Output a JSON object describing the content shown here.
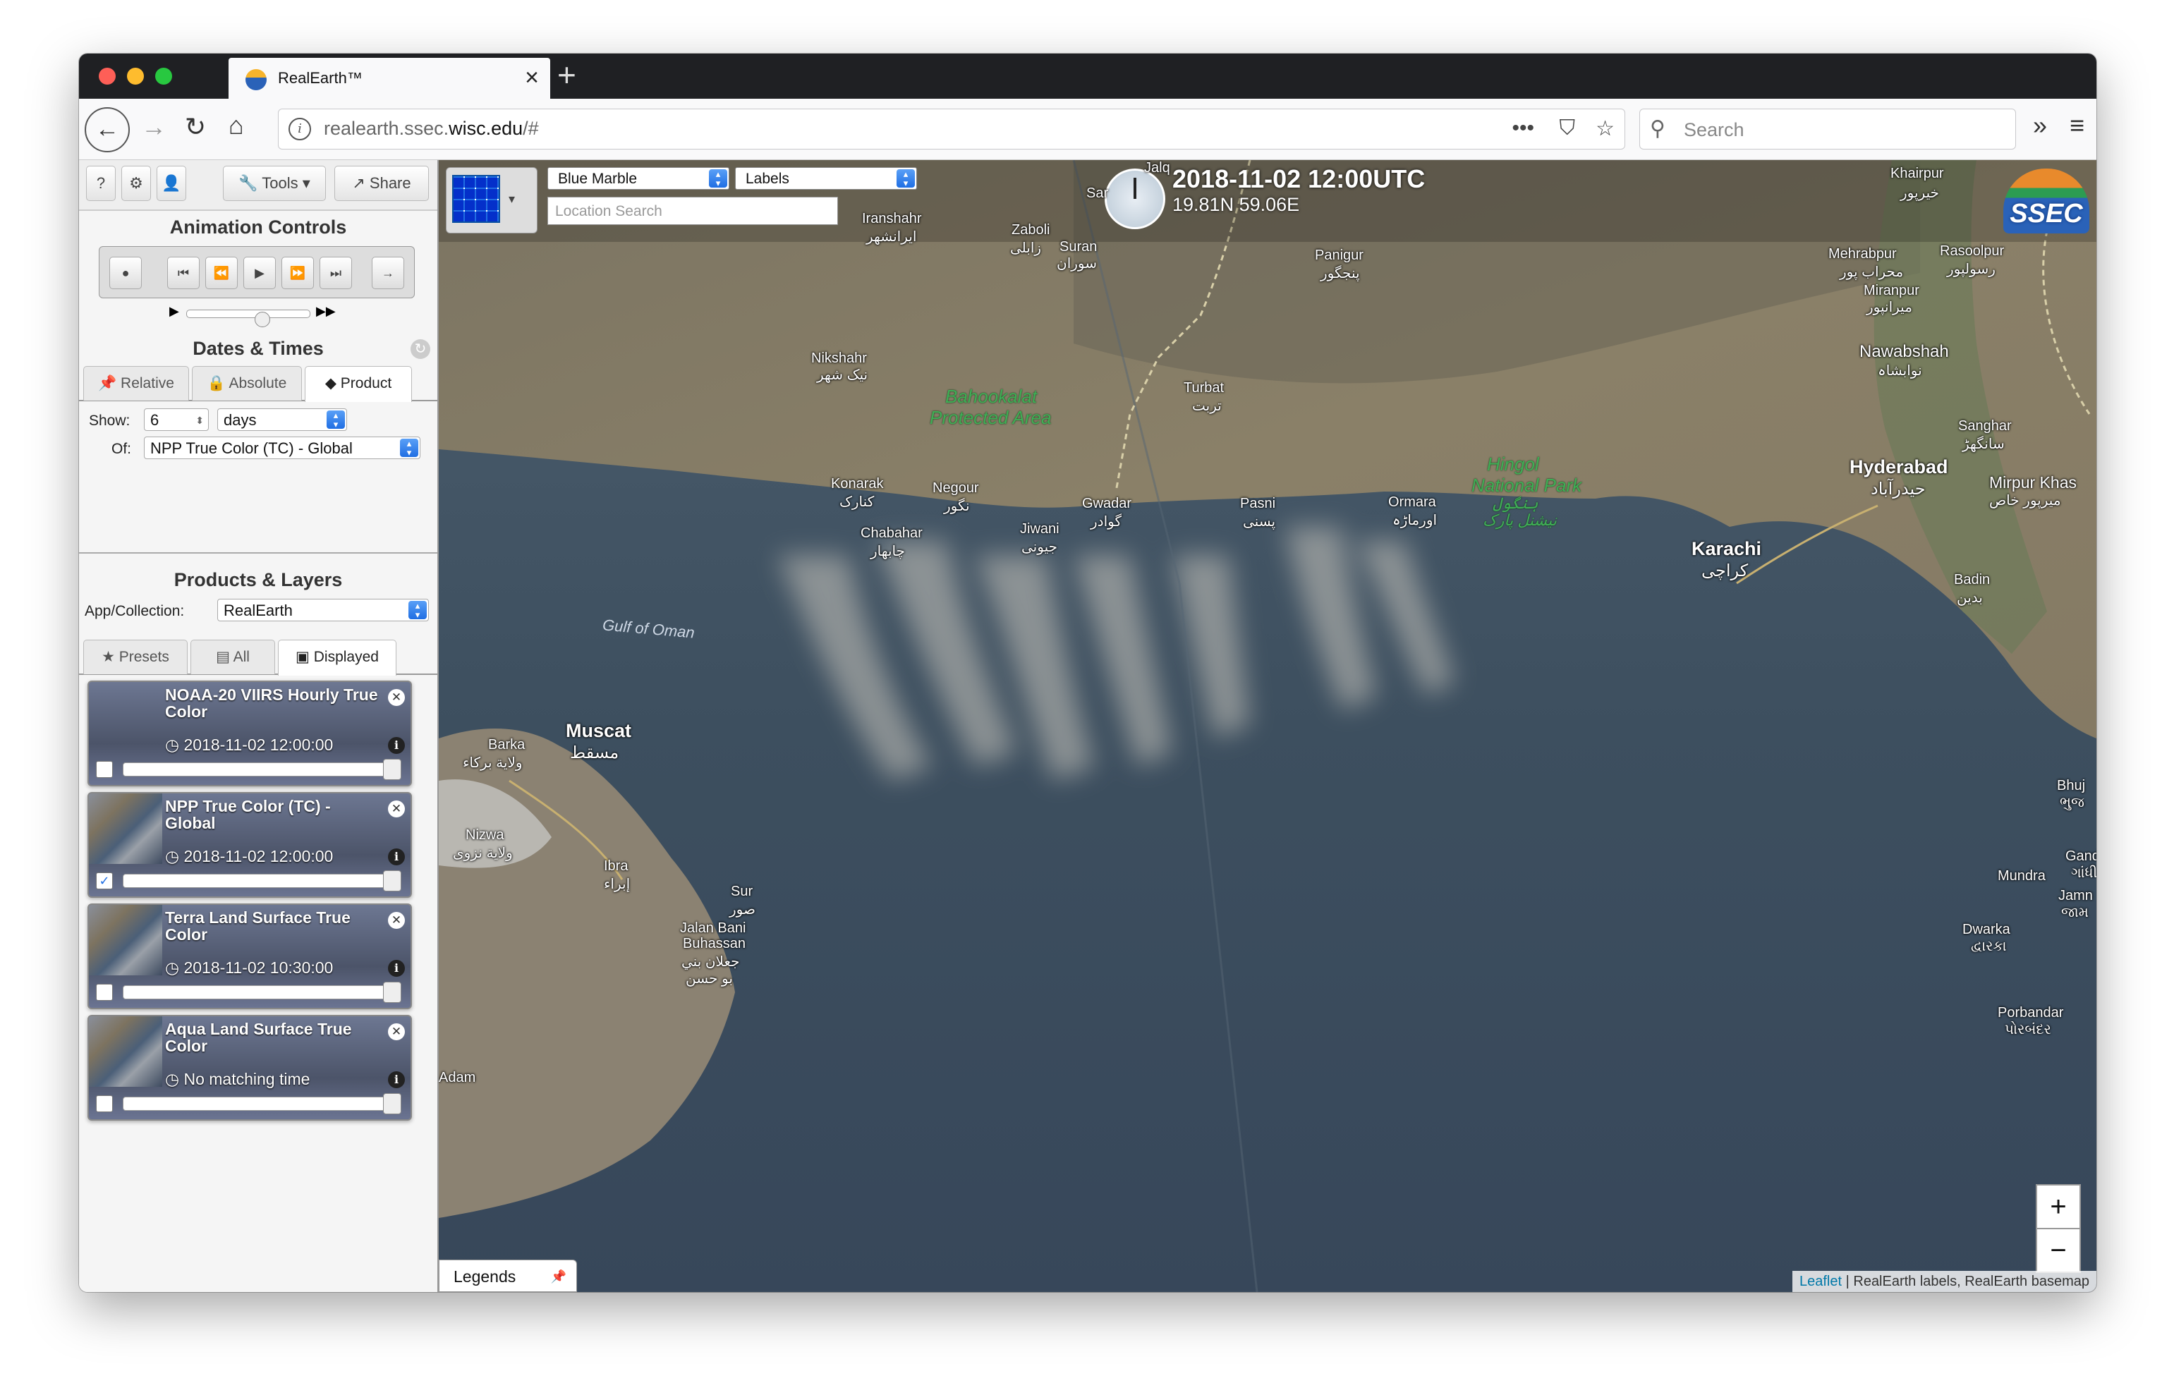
{
  "browser": {
    "tab_title": "RealEarth™",
    "url_host": "realearth.ssec.",
    "url_domain": "wisc.edu",
    "url_path": "/#",
    "search_placeholder": "Search"
  },
  "sidebar": {
    "top_buttons": {
      "help": "?",
      "settings": "⚙",
      "user": "👤",
      "tools": "Tools",
      "share": "Share"
    },
    "animation_title": "Animation Controls",
    "dates_title": "Dates & Times",
    "date_tabs": [
      "Relative",
      "Absolute",
      "Product"
    ],
    "show_label": "Show:",
    "show_value": "6",
    "show_unit": "days",
    "of_label": "Of:",
    "of_value": "NPP True Color (TC) - Global",
    "products_title": "Products & Layers",
    "app_label": "App/Collection:",
    "app_value": "RealEarth",
    "layer_tabs": [
      "Presets",
      "All",
      "Displayed"
    ],
    "layers": [
      {
        "name": "NOAA-20 VIIRS Hourly True Color",
        "time": "2018-11-02 12:00:00",
        "checked": false
      },
      {
        "name": "NPP True Color (TC) - Global",
        "time": "2018-11-02 12:00:00",
        "checked": true
      },
      {
        "name": "Terra Land Surface True Color",
        "time": "2018-11-02 10:30:00",
        "checked": false
      },
      {
        "name": "Aqua Land Surface True Color",
        "time": "No matching time",
        "checked": false
      }
    ]
  },
  "map": {
    "basemap": "Blue Marble",
    "labels": "Labels",
    "location_placeholder": "Location Search",
    "datetime": "2018-11-02 12:00UTC",
    "coords": "19.81N 59.06E",
    "logo": "SSEC",
    "legends": "Legends",
    "attribution_link": "Leaflet",
    "attribution_text": " | RealEarth labels, RealEarth basemap",
    "zoom_in": "+",
    "zoom_out": "−",
    "places": {
      "khairpur": "Khairpur",
      "khairpur_ur": "خيرپور",
      "iranshahr": "Iranshahr",
      "iranshahr_fa": "ایرانشهر",
      "zaboli": "Zaboli",
      "zaboli_fa": "زابلی",
      "suran": "Suran",
      "suran_fa": "سوران",
      "panigur": "Panigur",
      "panigur_ur": "پنجگور",
      "mehrabpur": "Mehrabpur",
      "mehrabpur_ur": "محراب پور",
      "rasoolpur": "Rasoolpur",
      "rasoolpur_ur": "رسولپور",
      "miranpur": "Miranpur",
      "miranpur_ur": "میرانپور",
      "nawabshah": "Nawabshah",
      "nawabshah_ur": "نوابشاہ",
      "nikshahr": "Nikshahr",
      "nikshahr_fa": "نیک شهر",
      "bahookalat": "Bahookalat",
      "protected": "Protected Area",
      "turbat": "Turbat",
      "turbat_ur": "تربت",
      "sanghar": "Sanghar",
      "sanghar_ur": "سانگھڑ",
      "hyderabad": "Hyderabad",
      "hyderabad_ur": "حیدرآباد",
      "mirpur": "Mirpur Khas",
      "mirpur_ur": "میرپور خاص",
      "konarak": "Konarak",
      "konarak_fa": "کنارک",
      "negour": "Negour",
      "negour_ur": "نگور",
      "gwadar": "Gwadar",
      "gwadar_ur": "گوادر",
      "pasni": "Pasni",
      "pasni_ur": "پسنی",
      "ormara": "Ormara",
      "ormara_ur": "اورماڑہ",
      "hingol": "Hingol",
      "national_park": "National Park",
      "hingol_ur": "ہنگول",
      "hingol_ur2": "نیشنل پارک",
      "chabahar": "Chabahar",
      "chabahar_fa": "چابهار",
      "jiwani": "Jiwani",
      "jiwani_ur": "جیونی",
      "karachi": "Karachi",
      "karachi_ur": "کراچی",
      "badin": "Badin",
      "badin_ur": "بدین",
      "gulf": "Gulf of Oman",
      "muscat": "Muscat",
      "muscat_ar": "مسقط",
      "barka": "Barka",
      "barka_ar": "ولاية بركاء",
      "nizwa": "Nizwa",
      "nizwa_ar": "ولاية نزوى",
      "ibra": "Ibra",
      "ibra_ar": "إبراء",
      "sur": "Sur",
      "sur_ar": "صور",
      "jalan": "Jalan Bani",
      "buhassan": "Buhassan",
      "jalan_ar": "جعلان بني",
      "jalan_ar2": "بو حسن",
      "adam": "Adam",
      "bhuj": "Bhuj",
      "bhuj_gu": "ભુજ",
      "gandhidham": "Gandhi",
      "gandhidham_gu": "ગાંધી",
      "mundra": "Mundra",
      "jamnagar": "Jamn",
      "jamnagar_gu": "જામ",
      "dwarka": "Dwarka",
      "dwarka_gu": "દ્વારકા",
      "porbandar": "Porbandar",
      "porbandar_gu": "પોરબંદર",
      "saravan": "Sar",
      "jalq": "Jalq"
    }
  }
}
